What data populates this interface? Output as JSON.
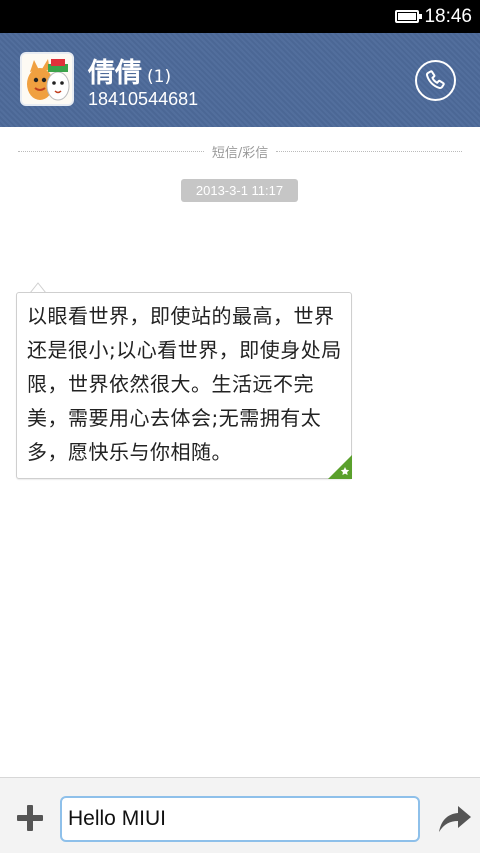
{
  "status_bar": {
    "time": "18:46",
    "battery_icon": "battery-full-icon"
  },
  "header": {
    "contact_name": "倩倩",
    "unread_count": "(1)",
    "phone_number": "18410544681",
    "call_icon": "phone-icon",
    "bg_color": "#4d6a9a"
  },
  "conversation": {
    "divider_label": "短信/彩信",
    "timestamp": "2013-3-1 11:17",
    "message": {
      "text": "以眼看世界，即使站的最高，世界还是很小;以心看世界，即使身处局限，世界依然很大。生活远不完美，需要用心去体会;无需拥有太多，愿快乐与你相随。",
      "corner_icon": "star-icon",
      "corner_color": "#5aa02c"
    }
  },
  "composer": {
    "add_icon": "plus-icon",
    "input_value": "Hello MIUI",
    "send_icon": "send-arrow-icon",
    "focus_color": "#8ec0ea"
  }
}
